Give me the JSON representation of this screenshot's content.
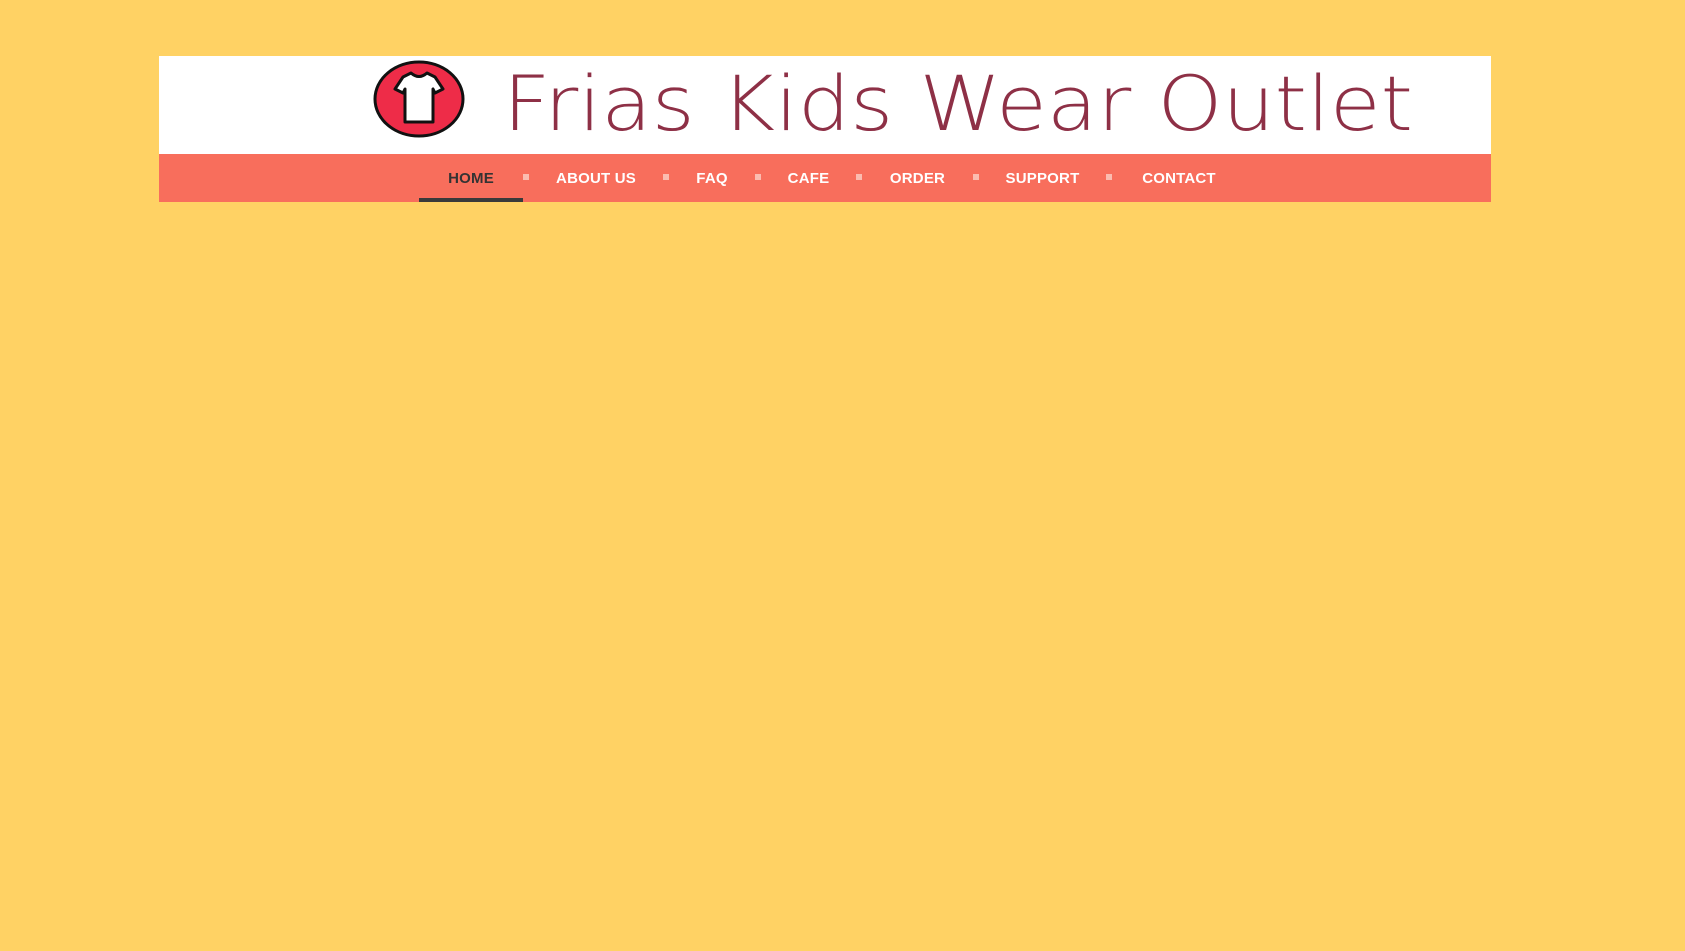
{
  "site": {
    "title": "Frias Kids Wear Outlet",
    "logo_icon": "tshirt-icon"
  },
  "nav": {
    "items": [
      {
        "label": "HOME",
        "active": true
      },
      {
        "label": "ABOUT US",
        "active": false
      },
      {
        "label": "FAQ",
        "active": false
      },
      {
        "label": "CAFE",
        "active": false
      },
      {
        "label": "ORDER",
        "active": false
      },
      {
        "label": "SUPPORT",
        "active": false
      },
      {
        "label": "CONTACT",
        "active": false
      }
    ],
    "separator_icon": "square-bullet-icon"
  },
  "colors": {
    "page_background": "#ffd264",
    "banner_background": "#ffffff",
    "nav_background": "#f86e5c",
    "title_color": "#8e3046",
    "logo_red": "#ee2c48",
    "active_underline": "#3a3a3a"
  }
}
